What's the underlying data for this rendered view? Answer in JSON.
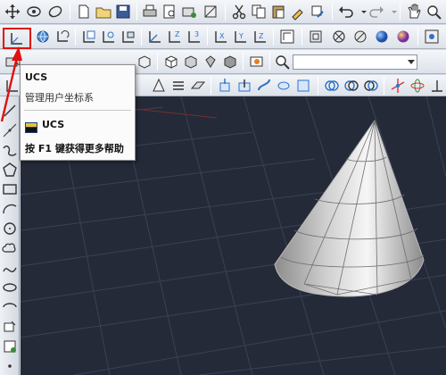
{
  "tooltip": {
    "title": "UCS",
    "description": "管理用户坐标系",
    "command_icon": "ucs-command-icon",
    "command": "UCS",
    "help_hint": "按 F1 键获得更多帮助"
  },
  "highlighted_tool": "ucs-icon",
  "colors": {
    "viewport_bg": "#242a38",
    "highlight": "#e01010",
    "arrow": "#e01010",
    "cone": "#d8d8d8"
  }
}
